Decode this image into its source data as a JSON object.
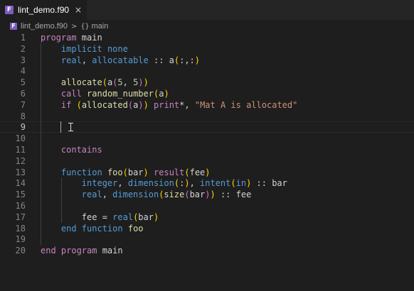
{
  "tab": {
    "label": "lint_demo.f90",
    "icon": "fortran-file-icon",
    "close": "×"
  },
  "breadcrumb": {
    "file": "lint_demo.f90",
    "separator": ">",
    "symbol_icon": "{}",
    "symbol": "main"
  },
  "colors": {
    "keyword_control": "#c586c0",
    "keyword_type": "#569cd6",
    "function": "#dcdcaa",
    "number": "#b5cea8",
    "string": "#ce9178",
    "text": "#d4d4d4",
    "background": "#1e1e1e"
  },
  "editor": {
    "active_line": 9,
    "lines": [
      {
        "n": "1",
        "tokens": [
          {
            "t": "program",
            "c": "k"
          },
          {
            "t": " main",
            "c": "v"
          }
        ]
      },
      {
        "n": "2",
        "tokens": [
          {
            "t": "    "
          },
          {
            "t": "implicit",
            "c": "b"
          },
          {
            "t": " "
          },
          {
            "t": "none",
            "c": "b"
          }
        ]
      },
      {
        "n": "3",
        "tokens": [
          {
            "t": "    "
          },
          {
            "t": "real",
            "c": "b"
          },
          {
            "t": ", "
          },
          {
            "t": "allocatable",
            "c": "b"
          },
          {
            "t": " :: a"
          },
          {
            "t": "(",
            "c": "br1"
          },
          {
            "t": ":,:"
          },
          {
            "t": ")",
            "c": "br1"
          }
        ]
      },
      {
        "n": "4",
        "tokens": []
      },
      {
        "n": "5",
        "tokens": [
          {
            "t": "    "
          },
          {
            "t": "allocate",
            "c": "f"
          },
          {
            "t": "(",
            "c": "br1"
          },
          {
            "t": "a"
          },
          {
            "t": "(",
            "c": "br2"
          },
          {
            "t": "5",
            "c": "n"
          },
          {
            "t": ", "
          },
          {
            "t": "5",
            "c": "n"
          },
          {
            "t": ")",
            "c": "br2"
          },
          {
            "t": ")",
            "c": "br1"
          }
        ]
      },
      {
        "n": "6",
        "tokens": [
          {
            "t": "    "
          },
          {
            "t": "call",
            "c": "k"
          },
          {
            "t": " "
          },
          {
            "t": "random_number",
            "c": "f"
          },
          {
            "t": "(",
            "c": "br1"
          },
          {
            "t": "a"
          },
          {
            "t": ")",
            "c": "br1"
          }
        ]
      },
      {
        "n": "7",
        "tokens": [
          {
            "t": "    "
          },
          {
            "t": "if",
            "c": "k"
          },
          {
            "t": " "
          },
          {
            "t": "(",
            "c": "br1"
          },
          {
            "t": "allocated",
            "c": "f"
          },
          {
            "t": "(",
            "c": "br2"
          },
          {
            "t": "a"
          },
          {
            "t": ")",
            "c": "br2"
          },
          {
            "t": ")",
            "c": "br1"
          },
          {
            "t": " "
          },
          {
            "t": "print",
            "c": "k"
          },
          {
            "t": "*, "
          },
          {
            "t": "\"Mat A is allocated\"",
            "c": "s"
          }
        ]
      },
      {
        "n": "8",
        "tokens": []
      },
      {
        "n": "9",
        "tokens": []
      },
      {
        "n": "10",
        "tokens": []
      },
      {
        "n": "11",
        "tokens": [
          {
            "t": "    "
          },
          {
            "t": "contains",
            "c": "k"
          }
        ]
      },
      {
        "n": "12",
        "tokens": []
      },
      {
        "n": "13",
        "tokens": [
          {
            "t": "    "
          },
          {
            "t": "function",
            "c": "b"
          },
          {
            "t": " "
          },
          {
            "t": "foo",
            "c": "f"
          },
          {
            "t": "(",
            "c": "br1"
          },
          {
            "t": "bar"
          },
          {
            "t": ")",
            "c": "br1"
          },
          {
            "t": " "
          },
          {
            "t": "result",
            "c": "k"
          },
          {
            "t": "(",
            "c": "br1"
          },
          {
            "t": "fee"
          },
          {
            "t": ")",
            "c": "br1"
          }
        ]
      },
      {
        "n": "14",
        "tokens": [
          {
            "t": "        "
          },
          {
            "t": "integer",
            "c": "b"
          },
          {
            "t": ", "
          },
          {
            "t": "dimension",
            "c": "b"
          },
          {
            "t": "(",
            "c": "br1"
          },
          {
            "t": ":"
          },
          {
            "t": ")",
            "c": "br1"
          },
          {
            "t": ", "
          },
          {
            "t": "intent",
            "c": "b"
          },
          {
            "t": "(",
            "c": "br1"
          },
          {
            "t": "in",
            "c": "b"
          },
          {
            "t": ")",
            "c": "br1"
          },
          {
            "t": " :: bar"
          }
        ]
      },
      {
        "n": "15",
        "tokens": [
          {
            "t": "        "
          },
          {
            "t": "real",
            "c": "b"
          },
          {
            "t": ", "
          },
          {
            "t": "dimension",
            "c": "b"
          },
          {
            "t": "(",
            "c": "br1"
          },
          {
            "t": "size",
            "c": "f"
          },
          {
            "t": "(",
            "c": "br2"
          },
          {
            "t": "bar"
          },
          {
            "t": ")",
            "c": "br2"
          },
          {
            "t": ")",
            "c": "br1"
          },
          {
            "t": " :: fee"
          }
        ]
      },
      {
        "n": "16",
        "tokens": []
      },
      {
        "n": "17",
        "tokens": [
          {
            "t": "        "
          },
          {
            "t": "fee = "
          },
          {
            "t": "real",
            "c": "b"
          },
          {
            "t": "(",
            "c": "br1"
          },
          {
            "t": "bar"
          },
          {
            "t": ")",
            "c": "br1"
          }
        ]
      },
      {
        "n": "18",
        "tokens": [
          {
            "t": "    "
          },
          {
            "t": "end function",
            "c": "b"
          },
          {
            "t": " "
          },
          {
            "t": "foo",
            "c": "f"
          }
        ]
      },
      {
        "n": "19",
        "tokens": []
      },
      {
        "n": "20",
        "tokens": [
          {
            "t": "end program",
            "c": "k"
          },
          {
            "t": " main",
            "c": "v"
          }
        ]
      }
    ]
  }
}
